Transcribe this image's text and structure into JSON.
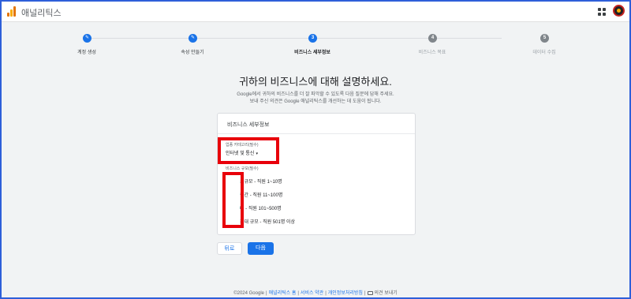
{
  "app": {
    "title": "애널리틱스"
  },
  "steps": [
    {
      "number": "✎",
      "label": "계정 생성",
      "state": "done"
    },
    {
      "number": "✎",
      "label": "속성 만들기",
      "state": "done"
    },
    {
      "number": "3",
      "label": "비즈니스 세부정보",
      "state": "active"
    },
    {
      "number": "4",
      "label": "비즈니스 목표",
      "state": "todo"
    },
    {
      "number": "5",
      "label": "데이터 수집",
      "state": "todo"
    }
  ],
  "main": {
    "heading": "귀하의 비즈니스에 대해 설명하세요.",
    "description_line1": "Google에서 귀하의 비즈니스를 더 잘 파악할 수 있도록 다음 질문에 답해 주세요.",
    "description_line2": "보내 주신 의견은 Google 애널리틱스를 개선하는 데 도움이 됩니다."
  },
  "card": {
    "title": "비즈니스 세부정보",
    "industry_label": "업종 카테고리(필수)",
    "industry_value": "인터넷 및 통신",
    "industry_caret": "▾",
    "size_label": "비즈니스 규모(필수)",
    "size_options": [
      {
        "label": "소규모 - 직원 1~10명",
        "checked": true
      },
      {
        "label": "중간 - 직원 11~100명",
        "checked": false
      },
      {
        "label": "대 - 직원 101~500명",
        "checked": false
      },
      {
        "label": "최대 규모 - 직원 501명 이상",
        "checked": false
      }
    ]
  },
  "buttons": {
    "back": "뒤로",
    "next": "다음"
  },
  "footer": {
    "copyright": "©2024 Google",
    "home": "애널리틱스 홈",
    "terms": "서비스 약관",
    "privacy": "개인정보처리방침",
    "feedback": "의견 보내기"
  },
  "colors": {
    "accent": "#1a73e8",
    "highlight": "#e8000b",
    "frame": "#2e5fd9"
  }
}
